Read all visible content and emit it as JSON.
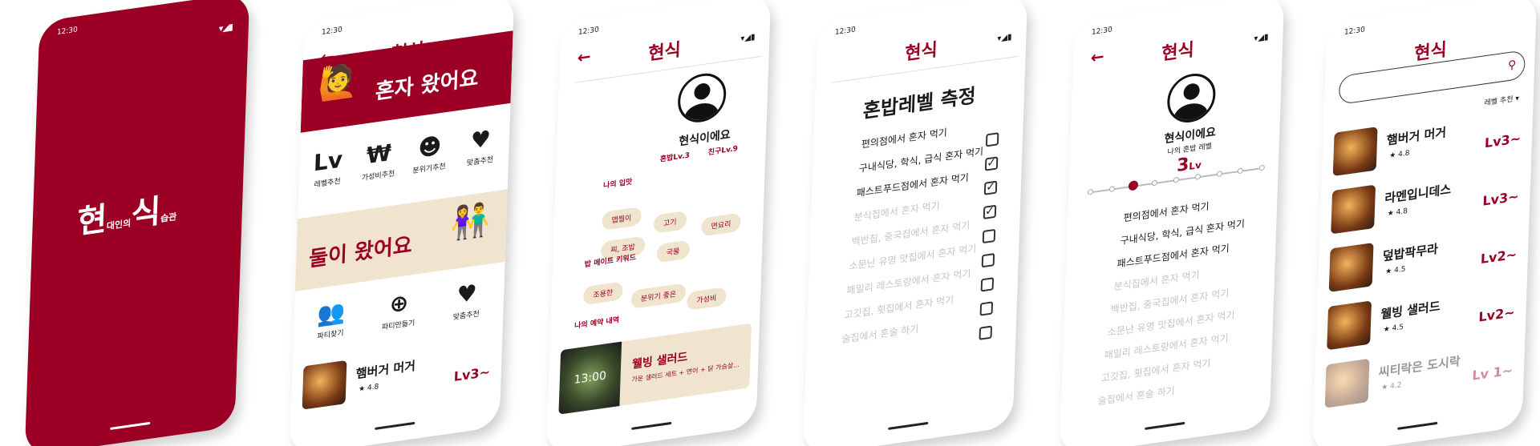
{
  "status": {
    "time": "12:30",
    "signal": "▾◢▮"
  },
  "app_title": "현식",
  "splash": {
    "logo_big1": "현",
    "logo_small1": "대인의",
    "logo_big2": "식",
    "logo_small2": "습관"
  },
  "screen2": {
    "banner1": "혼자 왔어요",
    "categories1": [
      {
        "icon": "Lv",
        "label": "레벨추천"
      },
      {
        "icon": "₩",
        "label": "가성비추천"
      },
      {
        "icon": "☻",
        "label": "분위기추천"
      },
      {
        "icon": "♥",
        "label": "맞춤추천"
      }
    ],
    "banner2": "둘이 왔어요",
    "categories2": [
      {
        "icon": "👥",
        "label": "파티찾기"
      },
      {
        "icon": "⊕",
        "label": "파티만들기"
      },
      {
        "icon": "♥",
        "label": "맞춤추천"
      }
    ],
    "item": {
      "name": "햄버거 머거",
      "rating": "★ 4.8",
      "level": "Lv3~"
    }
  },
  "screen3": {
    "name": "현식이에요",
    "level_solo": "혼밥Lv.3",
    "level_friend": "친구Lv.9",
    "taste_label": "나의 입맛",
    "tastes": [
      "맵찔이",
      "고기",
      "면요리",
      "찌, 조밥",
      "국물"
    ],
    "keyword_label": "밥 메이트 키워드",
    "keywords": [
      "조용한",
      "분위기 좋은",
      "가성비"
    ],
    "reserve_label": "나의 예약 내역",
    "reserve": {
      "time": "13:00",
      "name": "웰빙 샐러드",
      "desc": "가운 샐러드 세트 + 연어 + 닭 가슴살..."
    }
  },
  "screen4": {
    "title": "혼밥레벨 측정",
    "questions": [
      {
        "text": "편의점에서 혼자 먹기",
        "checked": false,
        "active": true
      },
      {
        "text": "구내식당, 학식, 급식 혼자 먹기",
        "checked": true,
        "active": true
      },
      {
        "text": "패스트푸드점에서 혼자 먹기",
        "checked": true,
        "active": true
      },
      {
        "text": "분식집에서 혼자 먹기",
        "checked": true,
        "active": false
      },
      {
        "text": "백반집, 중국집에서 혼자 먹기",
        "checked": false,
        "active": false
      },
      {
        "text": "소문난 유명 맛집에서 혼자 먹기",
        "checked": false,
        "active": false
      },
      {
        "text": "패밀리 레스토랑에서 혼자 먹기",
        "checked": false,
        "active": false
      },
      {
        "text": "고깃집, 횟집에서 혼자 먹기",
        "checked": false,
        "active": false
      },
      {
        "text": "술집에서 혼술 하기",
        "checked": false,
        "active": false
      }
    ]
  },
  "screen5": {
    "name": "현식이에요",
    "sub": "나의 혼밥 레벨",
    "level_num": "3",
    "level_unit": "Lv",
    "level_value": 3,
    "level_max": 9,
    "list": [
      {
        "text": "편의점에서 혼자 먹기",
        "active": true
      },
      {
        "text": "구내식당, 학식, 급식 혼자 먹기",
        "active": true
      },
      {
        "text": "패스트푸드점에서 혼자 먹기",
        "active": true
      },
      {
        "text": "분식집에서 혼자 먹기",
        "active": false
      },
      {
        "text": "백반집, 중국집에서 혼자 먹기",
        "active": false
      },
      {
        "text": "소문난 유명 맛집에서 혼자 먹기",
        "active": false
      },
      {
        "text": "패밀리 레스토랑에서 혼자 먹기",
        "active": false
      },
      {
        "text": "고깃집, 횟집에서 혼자 먹기",
        "active": false
      },
      {
        "text": "술집에서 혼술 하기",
        "active": false
      }
    ]
  },
  "screen6": {
    "search_placeholder": "",
    "sort": "레벨 추천 ▾",
    "results": [
      {
        "name": "햄버거 머거",
        "rating": "★ 4.8",
        "level": "Lv3~"
      },
      {
        "name": "라멘입니데스",
        "rating": "★ 4.8",
        "level": "Lv3~"
      },
      {
        "name": "덮밥팍무라",
        "rating": "★ 4.5",
        "level": "Lv2~"
      },
      {
        "name": "웰빙 샐러드",
        "rating": "★ 4.5",
        "level": "Lv2~"
      },
      {
        "name": "씨티락은 도시락",
        "rating": "★ 4.2",
        "level": "Lv 1~"
      }
    ]
  },
  "colors": {
    "brand": "#9b0024",
    "cream": "#f1e4cf"
  }
}
